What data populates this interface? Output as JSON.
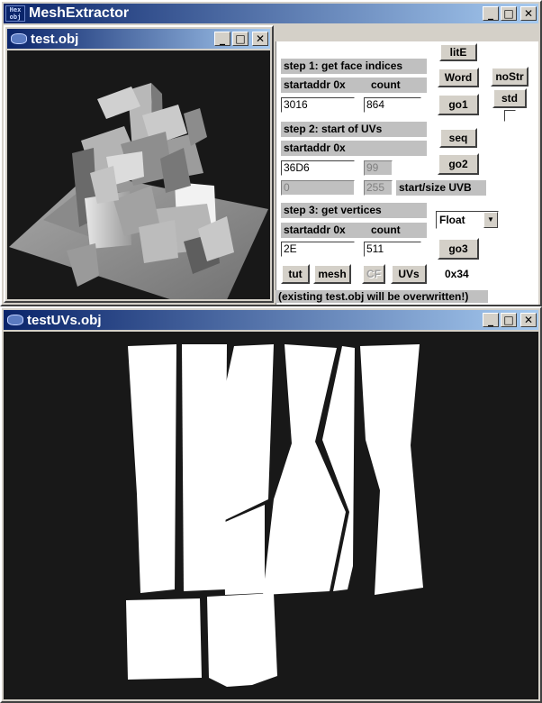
{
  "main_window": {
    "title": "MeshExtractor",
    "icon_text": [
      "Hex",
      "obj"
    ]
  },
  "preview_window": {
    "title": "test.obj"
  },
  "uv_window": {
    "title": "testUVs.obj"
  },
  "window_buttons": {
    "minimize": "_",
    "maximize": "□",
    "close": "✕"
  },
  "top_buttons": {
    "lite": "litE",
    "word": "Word",
    "nostr": "noStr",
    "std": "std"
  },
  "step1": {
    "heading": "step 1: get face indices",
    "startaddr_label": "startaddr 0x",
    "count_label": "count",
    "startaddr_value": "3016",
    "count_value": "864",
    "go_button": "go1"
  },
  "step2": {
    "heading": "step 2: start of UVs",
    "startaddr_label": "startaddr 0x",
    "seq_button": "seq",
    "startaddr_value": "36D6",
    "disabled_value_1": "99",
    "go_button": "go2",
    "disabled_value_2": "0",
    "disabled_value_3": "255",
    "start_size_label": "start/size UVB"
  },
  "step3": {
    "heading": "step 3: get vertices",
    "startaddr_label": "startaddr 0x",
    "count_label": "count",
    "startaddr_value": "2E",
    "count_value": "511",
    "go_button": "go3",
    "format_selected": "Float"
  },
  "bottom_buttons": {
    "tut": "tut",
    "mesh": "mesh",
    "cf": "CF",
    "uvs": "UVs",
    "stride": "0x34"
  },
  "warning_text": "(existing test.obj will be overwritten!)"
}
